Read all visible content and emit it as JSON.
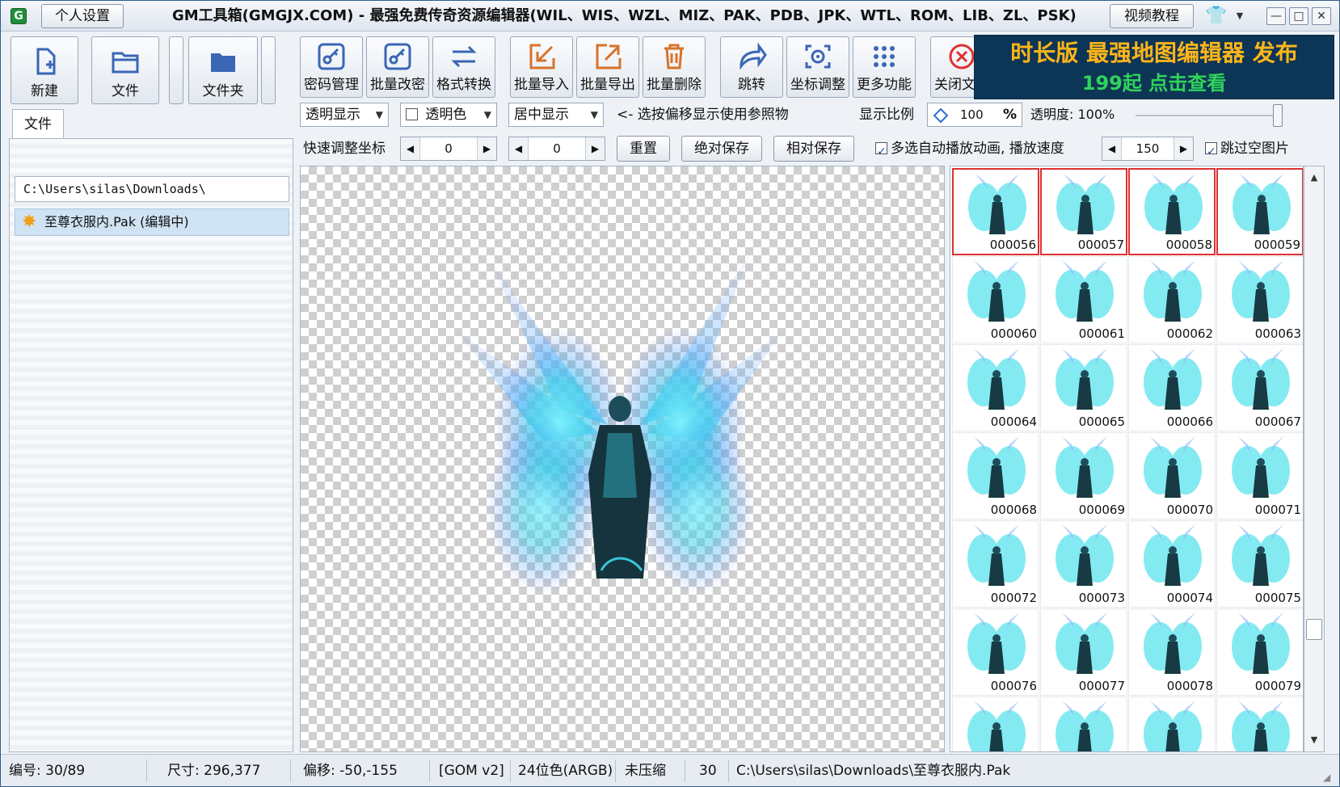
{
  "titlebar": {
    "personal_settings": "个人设置",
    "title": "GM工具箱(GMGJX.COM) - 最强免费传奇资源编辑器(WIL、WIS、WZL、MIZ、PAK、PDB、JPK、WTL、ROM、LIB、ZL、PSK)",
    "video_tutorial": "视频教程",
    "app_icon_letter": "G",
    "minimize": "—",
    "maximize": "□",
    "close": "✕"
  },
  "left": {
    "new_label": "新建",
    "file_label": "文件",
    "folder_label": "文件夹",
    "tab_label": "文件",
    "path": "C:\\Users\\silas\\Downloads\\",
    "file_item": "至尊衣服内.Pak (编辑中)"
  },
  "toolbar": {
    "password": "密码管理",
    "batch_password": "批量改密",
    "format_convert": "格式转换",
    "batch_import": "批量导入",
    "batch_export": "批量导出",
    "batch_delete": "批量删除",
    "jump": "跳转",
    "coord_adjust": "坐标调整",
    "more": "更多功能",
    "close_file": "关闭文件"
  },
  "ad": {
    "line1": "时长版 最强地图编辑器 发布",
    "line2": "199起 点击查看"
  },
  "options": {
    "transparent_display": "透明显示",
    "transparent_color": "透明色",
    "center_display": "居中显示",
    "hint": "<- 选按偏移显示使用参照物",
    "scale_label": "显示比例",
    "scale_value": "100",
    "scale_unit": "%",
    "opacity_label": "透明度: 100%",
    "opacity_value": 1.0
  },
  "coords": {
    "quick_label": "快速调整坐标",
    "x": "0",
    "y": "0",
    "reset": "重置",
    "abs_save": "绝对保存",
    "rel_save": "相对保存",
    "autoplay_label": "多选自动播放动画, 播放速度",
    "speed": "150",
    "skip_empty": "跳过空图片"
  },
  "thumbs": {
    "items": [
      {
        "num": "000056",
        "selected": true
      },
      {
        "num": "000057",
        "selected": true
      },
      {
        "num": "000058",
        "selected": true
      },
      {
        "num": "000059",
        "selected": true
      },
      {
        "num": "000060",
        "selected": false
      },
      {
        "num": "000061",
        "selected": false
      },
      {
        "num": "000062",
        "selected": false
      },
      {
        "num": "000063",
        "selected": false
      },
      {
        "num": "000064",
        "selected": false
      },
      {
        "num": "000065",
        "selected": false
      },
      {
        "num": "000066",
        "selected": false
      },
      {
        "num": "000067",
        "selected": false
      },
      {
        "num": "000068",
        "selected": false
      },
      {
        "num": "000069",
        "selected": false
      },
      {
        "num": "000070",
        "selected": false
      },
      {
        "num": "000071",
        "selected": false
      },
      {
        "num": "000072",
        "selected": false
      },
      {
        "num": "000073",
        "selected": false
      },
      {
        "num": "000074",
        "selected": false
      },
      {
        "num": "000075",
        "selected": false
      },
      {
        "num": "000076",
        "selected": false
      },
      {
        "num": "000077",
        "selected": false
      },
      {
        "num": "000078",
        "selected": false
      },
      {
        "num": "000079",
        "selected": false
      },
      {
        "num": "",
        "selected": false
      },
      {
        "num": "",
        "selected": false
      },
      {
        "num": "",
        "selected": false
      },
      {
        "num": "",
        "selected": false
      }
    ]
  },
  "status": {
    "index": "编号: 30/89",
    "size": "尺寸: 296,377",
    "offset": "偏移: -50,-155",
    "format": "[GOM v2]",
    "color_depth": "24位色(ARGB)",
    "compression": "未压缩",
    "count": "30",
    "path": "C:\\Users\\silas\\Downloads\\至尊衣服内.Pak"
  },
  "colors": {
    "accent": "#2e6fd0",
    "selected_border": "#e03030",
    "ad_bg": "#0d3556",
    "ad_gold": "#ffb51a",
    "ad_green": "#2fd45b",
    "icon_blue": "#3a66b5",
    "icon_orange": "#d8732a",
    "icon_red": "#e03030"
  }
}
